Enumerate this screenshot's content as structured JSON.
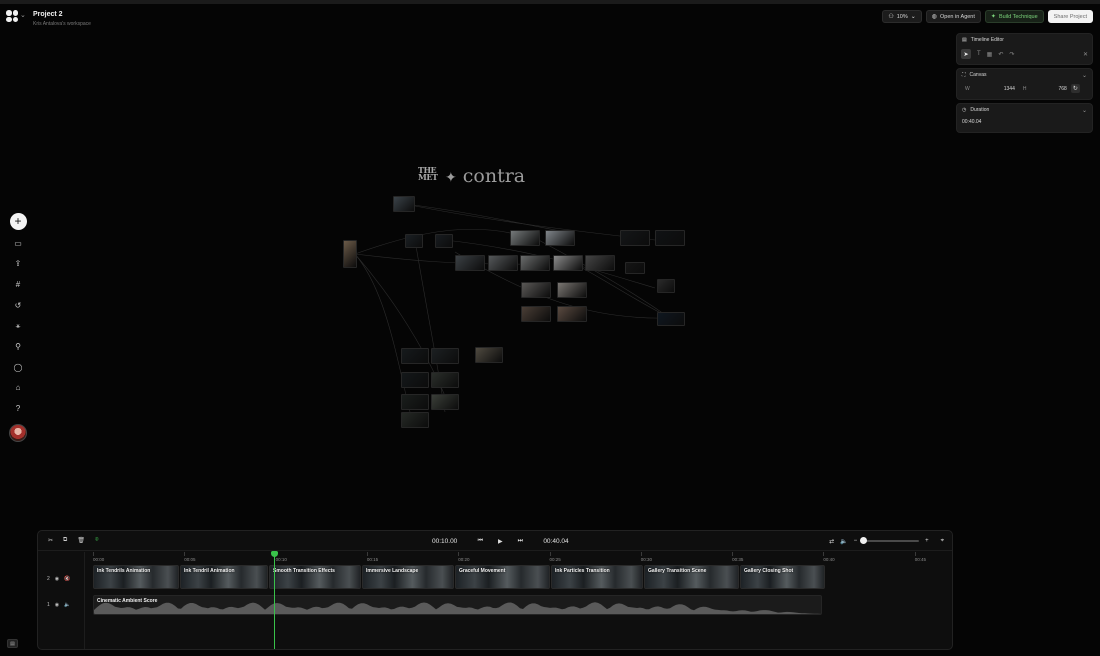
{
  "header": {
    "project_title": "Project 2",
    "workspace": "Kris Antalova's workspace",
    "zoom": "10%",
    "open_in_agent": "Open in Agent",
    "build_technique": "Build Technique",
    "share_project": "Share Project"
  },
  "panel": {
    "timeline_editor": "Timeline Editor",
    "canvas": {
      "title": "Canvas",
      "w_label": "W",
      "w_value": "1344",
      "h_label": "H",
      "h_value": "768"
    },
    "duration": {
      "title": "Duration",
      "value": "00:40.04"
    }
  },
  "canvas_brands": {
    "met": "THE MET",
    "contra": "contra"
  },
  "timeline": {
    "current_time": "00:10.00",
    "total_time": "00:40.04",
    "ruler": [
      "00:00",
      "00:05",
      "00:10",
      "00:15",
      "00:20",
      "00:25",
      "00:30",
      "00:35",
      "00:40",
      "00:45"
    ],
    "tracks": [
      {
        "number": "2"
      },
      {
        "number": "1"
      }
    ],
    "video_clips": [
      {
        "label": "Ink Tendrils Animation"
      },
      {
        "label": "Ink Tendril Animation"
      },
      {
        "label": "Smooth Transition Effects"
      },
      {
        "label": "Immersive Landscape"
      },
      {
        "label": "Graceful Movement"
      },
      {
        "label": "Ink Particles Transition"
      },
      {
        "label": "Gallery Transition Scene"
      },
      {
        "label": "Gallery Closing Shot"
      }
    ],
    "audio_clip": "Cinematic Ambient Score",
    "playhead_seconds": 10,
    "duration_seconds": 40.04
  }
}
